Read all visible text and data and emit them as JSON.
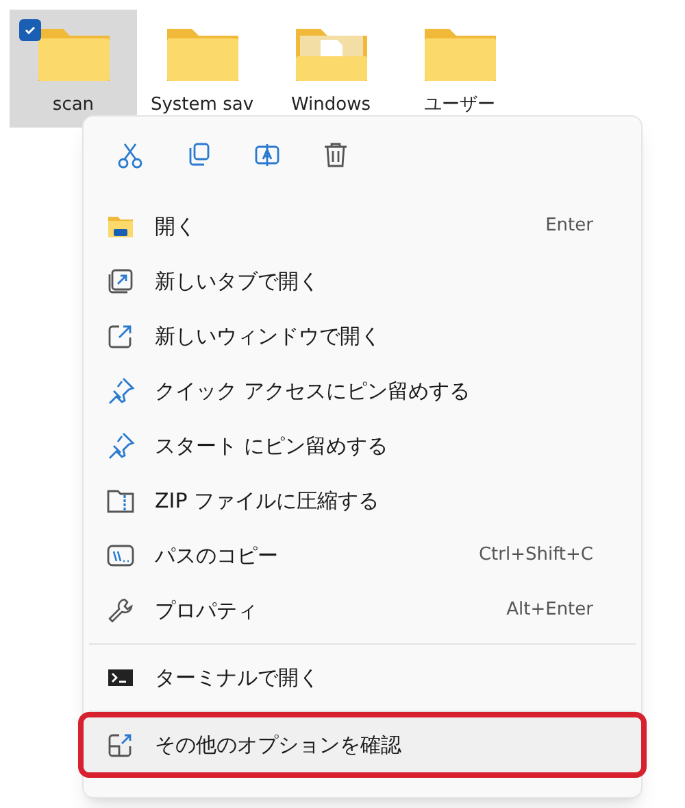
{
  "folders": [
    {
      "name": "scan",
      "selected": true,
      "kind": "plain"
    },
    {
      "name": "System sav",
      "selected": false,
      "kind": "plain"
    },
    {
      "name": "Windows",
      "selected": false,
      "kind": "document"
    },
    {
      "name": "ユーザー",
      "selected": false,
      "kind": "plain"
    }
  ],
  "context_menu": {
    "toolbar": [
      {
        "kind": "cut"
      },
      {
        "kind": "copy"
      },
      {
        "kind": "rename"
      },
      {
        "kind": "delete"
      }
    ],
    "groups": [
      [
        {
          "kind": "folder",
          "label": "開く",
          "shortcut": "Enter"
        },
        {
          "kind": "newtab",
          "label": "新しいタブで開く"
        },
        {
          "kind": "newwindow",
          "label": "新しいウィンドウで開く"
        },
        {
          "kind": "pin",
          "label": "クイック アクセスにピン留めする"
        },
        {
          "kind": "pin",
          "label": "スタート にピン留めする"
        },
        {
          "kind": "zip",
          "label": "ZIP ファイルに圧縮する"
        },
        {
          "kind": "path",
          "label": "パスのコピー",
          "shortcut": "Ctrl+Shift+C"
        },
        {
          "kind": "wrench",
          "label": "プロパティ",
          "shortcut": "Alt+Enter"
        }
      ],
      [
        {
          "kind": "terminal",
          "label": "ターミナルで開く"
        }
      ],
      [
        {
          "kind": "more",
          "label": "その他のオプションを確認",
          "highlighted": true
        }
      ]
    ]
  }
}
